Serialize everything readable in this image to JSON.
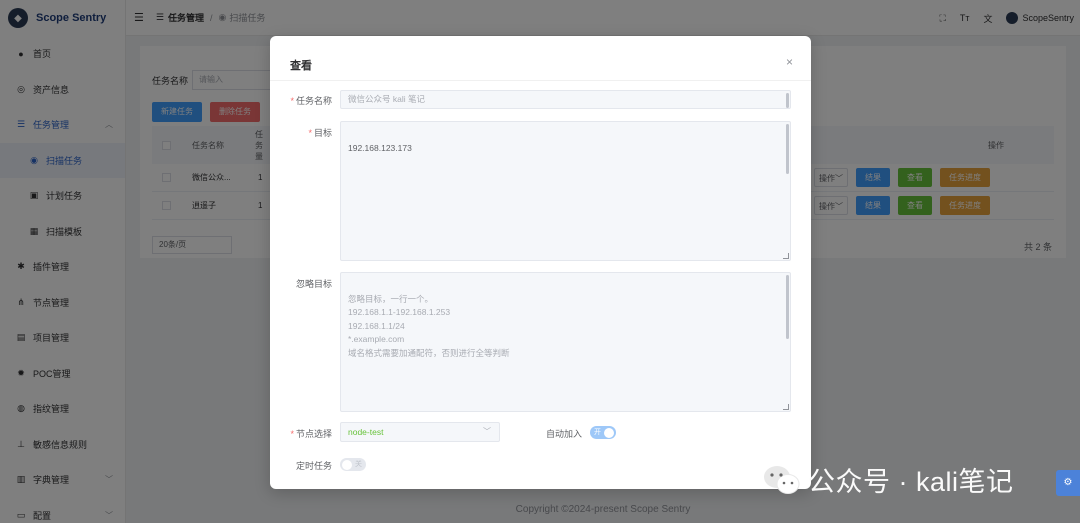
{
  "app": {
    "name": "Scope Sentry"
  },
  "sidebar": {
    "items": [
      {
        "label": "首页",
        "icon": "home-icon"
      },
      {
        "label": "资产信息",
        "icon": "eye-icon"
      },
      {
        "label": "任务管理",
        "icon": "list-icon"
      },
      {
        "label": "扫描任务",
        "icon": "eye-icon"
      },
      {
        "label": "计划任务",
        "icon": "edit-icon"
      },
      {
        "label": "扫描模板",
        "icon": "grid-icon"
      },
      {
        "label": "插件管理",
        "icon": "puzzle-icon"
      },
      {
        "label": "节点管理",
        "icon": "network-icon"
      },
      {
        "label": "项目管理",
        "icon": "folder-icon"
      },
      {
        "label": "POC管理",
        "icon": "bug-icon"
      },
      {
        "label": "指纹管理",
        "icon": "fingerprint-icon"
      },
      {
        "label": "敏感信息规则",
        "icon": "rule-icon"
      },
      {
        "label": "字典管理",
        "icon": "book-icon"
      },
      {
        "label": "配置",
        "icon": "settings-icon"
      }
    ]
  },
  "topbar": {
    "breadcrumb_1": "任务管理",
    "breadcrumb_sep": "/",
    "breadcrumb_2": "扫描任务",
    "font_icon": "Tт",
    "user": "ScopeSentry"
  },
  "page": {
    "search_label": "任务名称",
    "search_placeholder": "请输入",
    "new_task": "新建任务",
    "delete_task": "删除任务",
    "col_name": "任务名称",
    "col_count": "任务量",
    "col_ops": "操作",
    "rows": [
      {
        "name": "微信公众...",
        "count": "1"
      },
      {
        "name": "逍遥子",
        "count": "1"
      }
    ],
    "op_more": "操作",
    "op_result": "结果",
    "op_view": "查看",
    "op_progress": "任务进度",
    "page_size": "20条/页",
    "total": "共 2 条",
    "footer": "Copyright ©2024-present Scope Sentry"
  },
  "dialog": {
    "title": "查看",
    "close": "×",
    "task_name_label": "任务名称",
    "task_name_value": "微信公众号 kali 笔记",
    "target_label": "目标",
    "target_value": "192.168.123.173",
    "ignore_label": "忽略目标",
    "ignore_placeholder": "忽略目标，一行一个。\n192.168.1.1-192.168.1.253\n192.168.1.1/24\n*.example.com\n域名格式需要加通配符，否则进行全等判断",
    "node_label": "节点选择",
    "node_value": "node-test",
    "auto_join_label": "自动加入",
    "auto_join_on": "开",
    "scheduled_label": "定时任务",
    "scheduled_off": "关"
  },
  "watermark": {
    "text": "公众号 · kali笔记"
  },
  "colors": {
    "primary": "#409eff",
    "danger": "#f56c6c",
    "success": "#67c23a",
    "warning": "#e6a23c",
    "active_menu": "#2d64c9"
  }
}
